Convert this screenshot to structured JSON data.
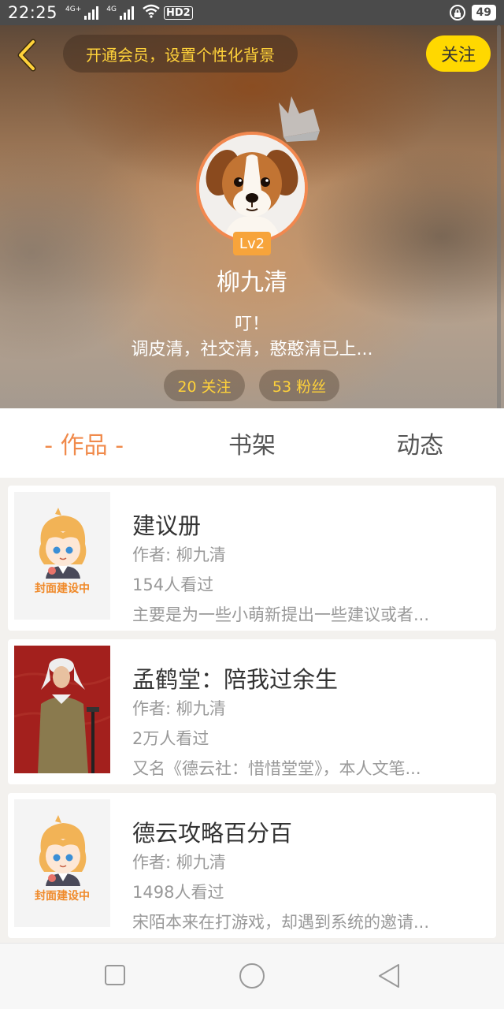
{
  "status_bar": {
    "time": "22:25",
    "signal1": "4G+",
    "signal2": "4G",
    "hd": "HD2",
    "battery": "49"
  },
  "header": {
    "vip_banner": "开通会员，设置个性化背景",
    "follow_button": "关注",
    "level_badge": "Lv2",
    "username": "柳九清",
    "bio_line1": "叮！",
    "bio_line2": "调皮清，社交清，憨憨清已上...",
    "following_stat": "20 关注",
    "fans_stat": "53 粉丝"
  },
  "tabs": [
    {
      "label": "- 作品 -",
      "active": true
    },
    {
      "label": "书架",
      "active": false
    },
    {
      "label": "动态",
      "active": false
    }
  ],
  "books": [
    {
      "title": "建议册",
      "author": "作者: 柳九清",
      "views": "154人看过",
      "description": "主要是为一些小萌新提出一些建议或者...",
      "cover_caption": "封面建设中"
    },
    {
      "title": "孟鹤堂：陪我过余生",
      "author": "作者: 柳九清",
      "views": "2万人看过",
      "description": "又名《德云社：惜惜堂堂》，本人文笔...",
      "cover_caption": ""
    },
    {
      "title": "德云攻略百分百",
      "author": "作者: 柳九清",
      "views": "1498人看过",
      "description": "宋陌本来在打游戏，却遇到系统的邀请...",
      "cover_caption": "封面建设中"
    }
  ],
  "colors": {
    "accent": "#f08a4b",
    "follow_yellow": "#ffd800",
    "vip_text": "#ffd23a"
  }
}
